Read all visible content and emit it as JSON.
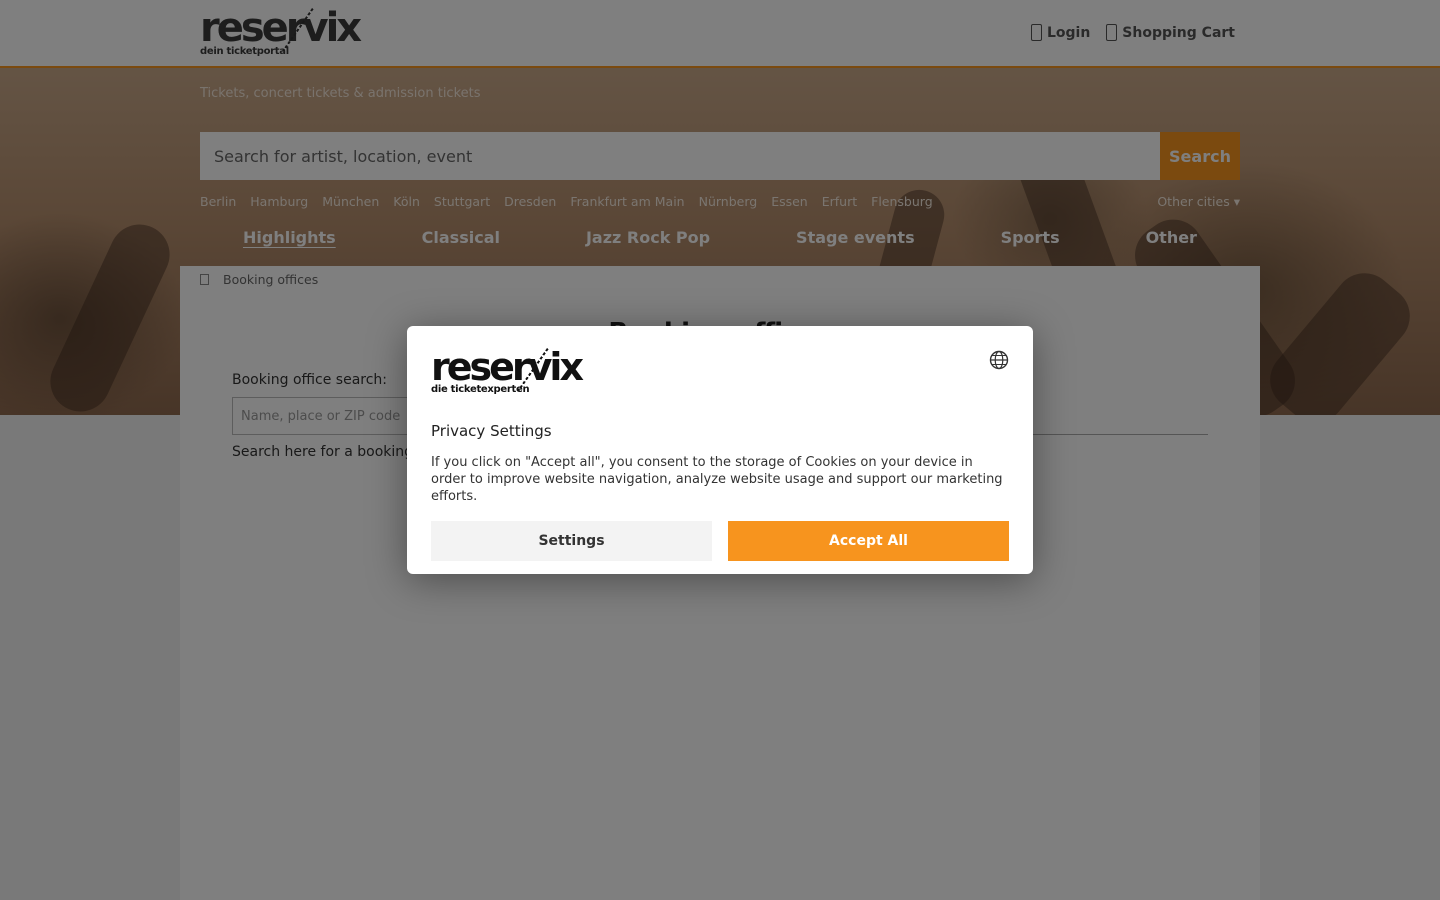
{
  "header": {
    "logo_word": "reservix",
    "logo_sub": "dein ticketportal",
    "login_label": "Login",
    "cart_label": "Shopping Cart"
  },
  "hero": {
    "tagline": "Tickets, concert tickets & admission tickets",
    "search_placeholder": "Search for artist, location, event",
    "search_button": "Search",
    "cities": [
      "Berlin",
      "Hamburg",
      "München",
      "Köln",
      "Stuttgart",
      "Dresden",
      "Frankfurt am Main",
      "Nürnberg",
      "Essen",
      "Erfurt",
      "Flensburg"
    ],
    "other_cities": "Other cities",
    "categories": [
      "Highlights",
      "Classical",
      "Jazz Rock Pop",
      "Stage events",
      "Sports",
      "Other"
    ]
  },
  "main": {
    "breadcrumb": "Booking offices",
    "title": "Booking offices",
    "search_label": "Booking office search:",
    "search_placeholder": "Name, place or ZIP code",
    "hint": "Search here for a booking office near you"
  },
  "modal": {
    "logo_word": "reservix",
    "logo_sub": "die ticketexperten",
    "title": "Privacy Settings",
    "text": "If you click on \"Accept all\", you consent to the storage of Cookies on your device in order to improve website navigation, analyze website usage and support our marketing efforts.",
    "settings_button": "Settings",
    "accept_button": "Accept All"
  },
  "colors": {
    "accent": "#f7941e",
    "overlay": "rgba(0,0,0,0.5)"
  },
  "icons": [
    "login-icon",
    "cart-icon",
    "home-icon",
    "globe-icon",
    "chevron-down-icon"
  ]
}
